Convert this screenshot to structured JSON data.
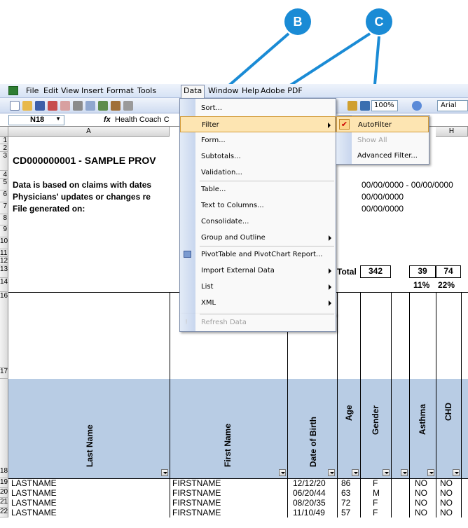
{
  "callouts": {
    "b": "B",
    "c": "C"
  },
  "menubar": {
    "items": [
      "File",
      "Edit",
      "View",
      "Insert",
      "Format",
      "Tools",
      "Data",
      "Window",
      "Help",
      "Adobe PDF"
    ]
  },
  "toolbar": {
    "zoom": "100%",
    "font": "Arial"
  },
  "formula_bar": {
    "namebox": "N18",
    "fx": "fx",
    "content": "Health Coach C"
  },
  "columns": [
    "A",
    "H"
  ],
  "rows": [
    "1",
    "2",
    "3",
    "4",
    "5",
    "6",
    "7",
    "8",
    "9",
    "10",
    "11",
    "12",
    "13",
    "14",
    "16",
    "17",
    "18",
    "19",
    "20",
    "21",
    "22"
  ],
  "sheet": {
    "title": "CD000000001 - SAMPLE PROV",
    "line5": "Data is based on claims with dates",
    "line6": "Physicians' updates or changes re",
    "line7": "File generated on:",
    "date_range": "00/00/0000 - 00/00/0000",
    "date6": "00/00/0000",
    "date7": "00/00/0000",
    "total_label": "Total",
    "total_value": "342",
    "asthma_count": "39",
    "chd_count": "74",
    "asthma_pct": "11%",
    "chd_pct": "22%",
    "headers": [
      "Last Name",
      "First Name",
      "Date of Birth",
      "Age",
      "Gender",
      "Asthma",
      "CHD"
    ],
    "data_rows": [
      {
        "last": "LASTNAME",
        "first": "FIRSTNAME",
        "dob": "12/12/20",
        "age": "86",
        "gender": "F",
        "asthma": "NO",
        "chd": "NO"
      },
      {
        "last": "LASTNAME",
        "first": "FIRSTNAME",
        "dob": "06/20/44",
        "age": "63",
        "gender": "M",
        "asthma": "NO",
        "chd": "NO"
      },
      {
        "last": "LASTNAME",
        "first": "FIRSTNAME",
        "dob": "08/20/35",
        "age": "72",
        "gender": "F",
        "asthma": "NO",
        "chd": "NO"
      },
      {
        "last": "LASTNAME",
        "first": "FIRSTNAME",
        "dob": "11/10/49",
        "age": "57",
        "gender": "F",
        "asthma": "NO",
        "chd": "NO"
      }
    ]
  },
  "data_menu": {
    "items": [
      "Sort...",
      "Filter",
      "Form...",
      "Subtotals...",
      "Validation...",
      "Table...",
      "Text to Columns...",
      "Consolidate...",
      "Group and Outline",
      "PivotTable and PivotChart Report...",
      "Import External Data",
      "List",
      "XML",
      "Refresh Data"
    ]
  },
  "filter_menu": {
    "items": [
      "AutoFilter",
      "Show All",
      "Advanced Filter..."
    ]
  },
  "colors": {
    "callout": "#1a8bd5",
    "header_blue": "#b8cce4",
    "menu_highlight": "#fde5b2"
  }
}
